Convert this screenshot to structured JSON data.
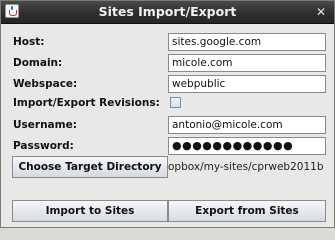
{
  "window": {
    "title": "Sites Import/Export",
    "close_glyph": "✕",
    "app_icon": "java-cup-icon"
  },
  "form": {
    "host_label": "Host:",
    "host_value": "sites.google.com",
    "domain_label": "Domain:",
    "domain_value": "micole.com",
    "webspace_label": "Webspace:",
    "webspace_value": "webpublic",
    "revisions_label": "Import/Export Revisions:",
    "revisions_checked": false,
    "username_label": "Username:",
    "username_value": "antonio@micole.com",
    "password_label": "Password:",
    "password_value": "●●●●●●●●●●●●",
    "choose_dir_label": "Choose Target Directory",
    "target_dir_value": "opbox/my-sites/cprweb2011b"
  },
  "actions": {
    "import_label": "Import to Sites",
    "export_label": "Export from Sites"
  }
}
